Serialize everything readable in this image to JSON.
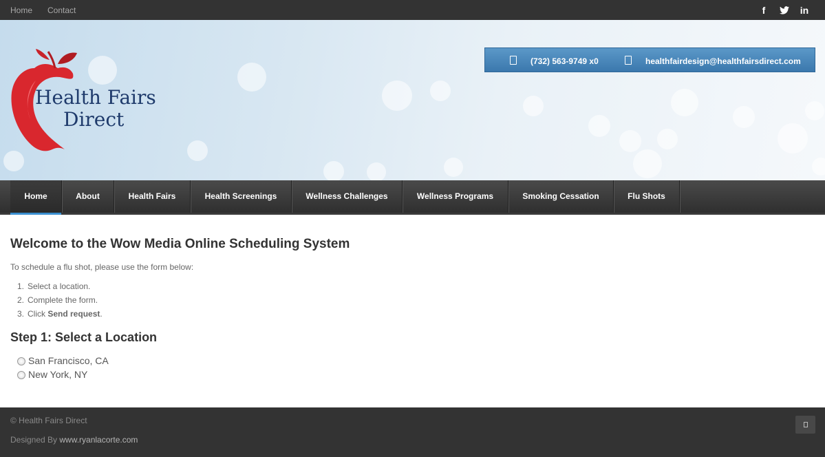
{
  "topbar": {
    "links": [
      "Home",
      "Contact"
    ],
    "social": [
      {
        "icon": "facebook-icon",
        "glyph": "f"
      },
      {
        "icon": "twitter-icon",
        "glyph": "t"
      },
      {
        "icon": "linkedin-icon",
        "glyph": "in"
      }
    ]
  },
  "header": {
    "logo_line1": "Health Fairs",
    "logo_line2": "Direct",
    "phone": "(732) 563-9749 x0",
    "email": "healthfairdesign@healthfairsdirect.com"
  },
  "nav": {
    "items": [
      "Home",
      "About",
      "Health Fairs",
      "Health Screenings",
      "Wellness Challenges",
      "Wellness Programs",
      "Smoking Cessation",
      "Flu Shots"
    ],
    "active": "Home"
  },
  "content": {
    "title": "Welcome to the Wow Media Online Scheduling System",
    "intro": "To schedule a flu shot, please use the form below:",
    "steps": [
      {
        "num": "1.",
        "text": "Select a location."
      },
      {
        "num": "2.",
        "text": "Complete the form."
      },
      {
        "num": "3.",
        "text_prefix": "Click ",
        "text_bold": "Send request",
        "text_suffix": "."
      }
    ],
    "step1_title": "Step 1: Select a Location",
    "locations": [
      "San Francisco, CA",
      "New York, NY"
    ]
  },
  "footer": {
    "copyright": "© Health Fairs Direct",
    "designed_prefix": "Designed By ",
    "designed_link": "www.ryanlacorte.com"
  },
  "colors": {
    "dark_bar": "#333333",
    "accent_blue": "#3b8fd0",
    "contact_blue": "#4a88bd",
    "apple_red": "#d9272e",
    "logo_navy": "#1e3a6b"
  }
}
